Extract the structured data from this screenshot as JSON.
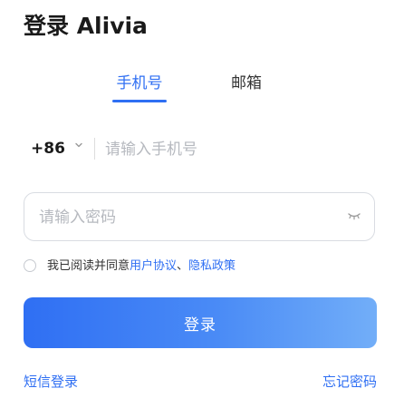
{
  "header": {
    "title": "登录 Alivia"
  },
  "tabs": [
    {
      "label": "手机号",
      "active": true
    },
    {
      "label": "邮箱",
      "active": false
    }
  ],
  "phone": {
    "country_code": "+86",
    "placeholder": "请输入手机号"
  },
  "password": {
    "placeholder": "请输入密码"
  },
  "agreement": {
    "prefix": "我已阅读并同意",
    "user_agreement": "用户协议",
    "separator": "、",
    "privacy_policy": "隐私政策"
  },
  "login_button": {
    "label": "登录"
  },
  "footer": {
    "sms_login": "短信登录",
    "forgot_password": "忘记密码"
  },
  "colors": {
    "accent": "#2f6ff3",
    "placeholder": "#b6b9bf",
    "border": "#d9dce2"
  }
}
